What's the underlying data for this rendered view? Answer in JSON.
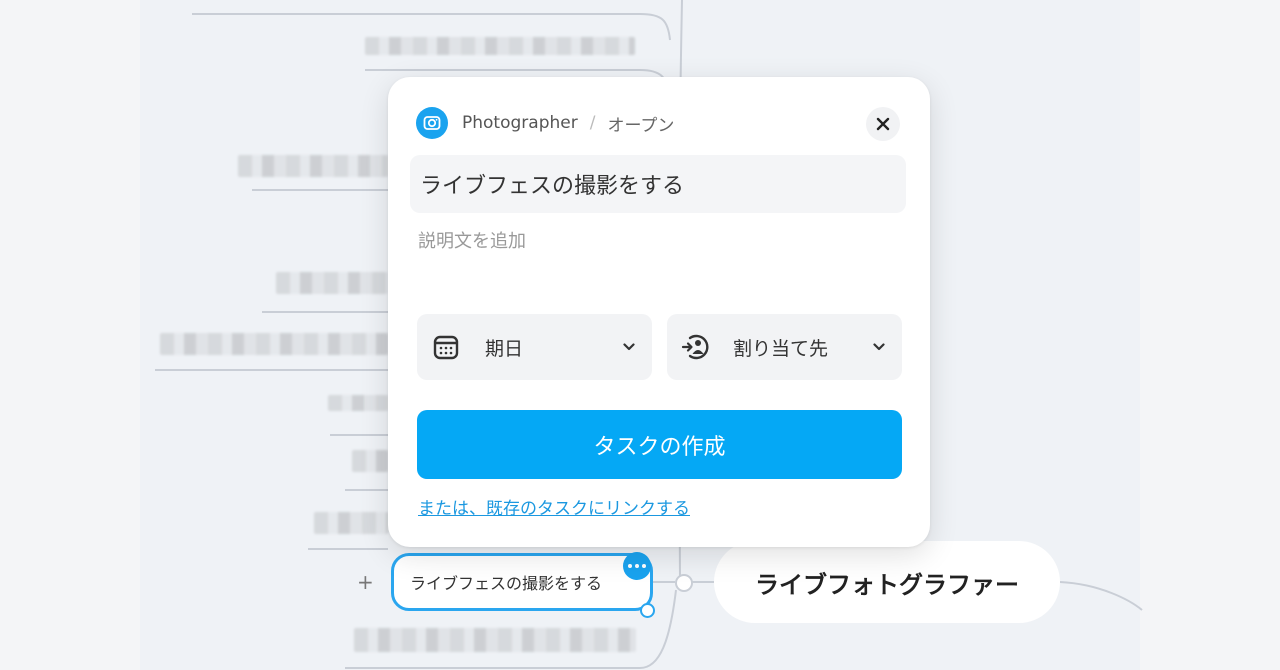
{
  "colors": {
    "accent": "#05a8f5",
    "node_border": "#2aa6ef",
    "link": "#1b98e0"
  },
  "task_card": {
    "project_icon": "camera-icon",
    "project_name": "Photographer",
    "breadcrumb_separator": "/",
    "status": "オープン",
    "close_icon": "close-icon",
    "title_value": "ライブフェスの撮影をする",
    "description_placeholder": "説明文を追加",
    "due_date": {
      "icon": "calendar-icon",
      "label": "期日"
    },
    "assignee": {
      "icon": "assignee-icon",
      "label": "割り当て先"
    },
    "create_button": "タスクの作成",
    "link_existing": "または、既存のタスクにリンクする"
  },
  "mindmap": {
    "selected_node_text": "ライブフェスの撮影をする",
    "root_node_text": "ライブフォトグラファー",
    "add_icon": "+"
  }
}
